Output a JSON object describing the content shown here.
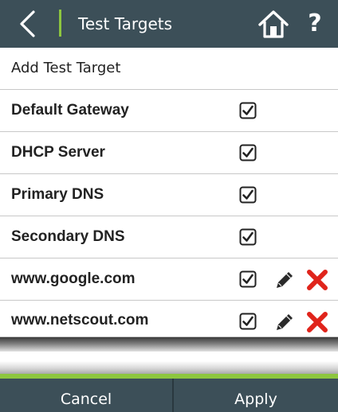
{
  "header": {
    "title": "Test Targets",
    "back_icon": "chevron-left-icon",
    "home_icon": "home-icon",
    "help_label": "?"
  },
  "list": {
    "add_label": "Add Test Target",
    "items": [
      {
        "label": "Default Gateway",
        "checked": true,
        "editable": false
      },
      {
        "label": "DHCP Server",
        "checked": true,
        "editable": false
      },
      {
        "label": "Primary DNS",
        "checked": true,
        "editable": false
      },
      {
        "label": "Secondary DNS",
        "checked": true,
        "editable": false
      },
      {
        "label": "www.google.com",
        "checked": true,
        "editable": true
      },
      {
        "label": "www.netscout.com",
        "checked": true,
        "editable": true
      }
    ]
  },
  "footer": {
    "cancel_label": "Cancel",
    "apply_label": "Apply"
  },
  "colors": {
    "header_bg": "#3c4f58",
    "accent_green": "#8dc63f",
    "delete_red": "#e0241b"
  }
}
